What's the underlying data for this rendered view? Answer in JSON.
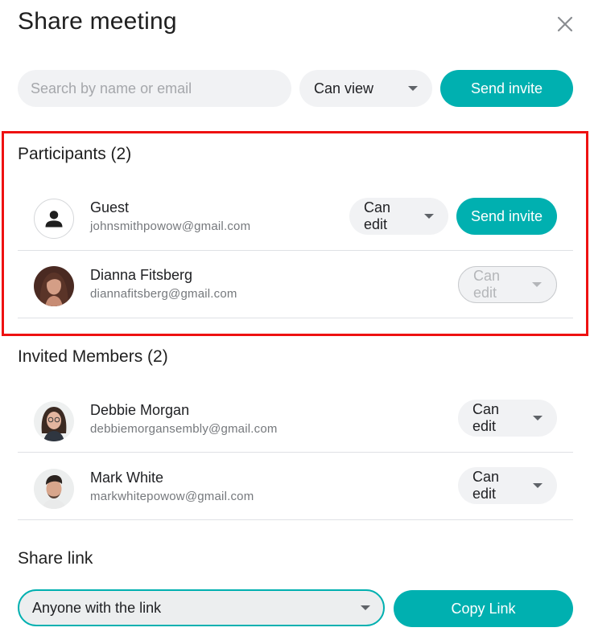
{
  "dialog": {
    "title": "Share meeting",
    "close_icon": "close-icon"
  },
  "invite_bar": {
    "search_placeholder": "Search by name or email",
    "permission": "Can view",
    "send_label": "Send invite"
  },
  "participants": {
    "heading": "Participants (2)",
    "items": [
      {
        "name": "Guest",
        "email": "johnsmithpowow@gmail.com",
        "permission": "Can edit",
        "action": "Send invite",
        "avatar": "person-icon"
      },
      {
        "name": "Dianna Fitsberg",
        "email": "diannafitsberg@gmail.com",
        "permission": "Can edit",
        "avatar": "avatar-photo"
      }
    ]
  },
  "invited": {
    "heading": "Invited Members (2)",
    "items": [
      {
        "name": "Debbie Morgan",
        "email": "debbiemorgansembly@gmail.com",
        "permission": "Can edit",
        "avatar": "avatar-photo"
      },
      {
        "name": "Mark White",
        "email": "markwhitepowow@gmail.com",
        "permission": "Can edit",
        "avatar": "avatar-photo"
      }
    ]
  },
  "share_link": {
    "heading": "Share link",
    "access": "Anyone with the link",
    "copy_label": "Copy Link"
  },
  "colors": {
    "accent": "#00b0b0",
    "highlight_border": "#ee1111",
    "pill_bg": "#f1f2f4"
  }
}
